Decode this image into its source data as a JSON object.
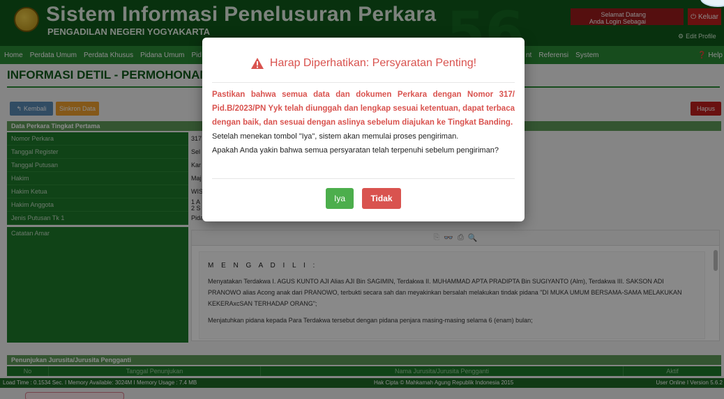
{
  "header": {
    "title": "Sistem Informasi Penelusuran Perkara",
    "subtitle": "PENGADILAN NEGERI YOGYAKARTA",
    "welcome_line1": "Selamat Datang",
    "welcome_line2": "Anda Login Sebagai",
    "logout_label": "Keluar",
    "edit_profile_label": "Edit Profile"
  },
  "nav": {
    "items": [
      "Home",
      "Perdata Umum",
      "Perdata Khusus",
      "Pidana Umum",
      "Pid"
    ],
    "right_items": [
      "nt",
      "Referensi",
      "System"
    ],
    "help_label": "Help"
  },
  "page": {
    "title": "INFORMASI DETIL - PERMOHONAN BAN",
    "back_label": "Kembali",
    "sync_label": "Sinkron Data",
    "delete_label": "Hapus"
  },
  "detail": {
    "section_title": "Data Perkara Tingkat Pertama",
    "rows": [
      {
        "label": "Nomor Perkara",
        "value": "317"
      },
      {
        "label": "Tanggal Register",
        "value": "Sel"
      },
      {
        "label": "Tanggal Putusan",
        "value": "Kar"
      },
      {
        "label": "Hakim",
        "value": "Maj"
      },
      {
        "label": "Hakim Ketua",
        "value": "WIS"
      },
      {
        "label": "Hakim Anggota",
        "value_line1": "1 A",
        "value_line2": "2 S"
      },
      {
        "label": "Jenis Putusan Tk 1",
        "value": "Pidana Penjara Waktu Tertentu"
      },
      {
        "label": "Catatan Amar"
      }
    ]
  },
  "amar": {
    "heading": "M E N G A D I L I :",
    "paragraph1": "Menyatakan Terdakwa I. AGUS KUNTO AJI Alias AJI Bin SAGIMIN, Terdakwa II. MUHAMMAD APTA PRADIPTA Bin SUGIYANTO (Alm), Terdakwa III. SAKSON ADI PRANOWO alias Acong anak dari PRANOWO, terbukti secara sah dan meyakinkan bersalah melakukan tindak pidana \"DI MUKA UMUM  BERSAMA-SAMA MELAKUKAN KEKERAxcSAN TERHADAP ORANG\";",
    "paragraph2": "Menjatuhkan pidana kepada Para Terdakwa tersebut dengan pidana penjara masing-masing selama 6 (enam) bulan;"
  },
  "jurusita": {
    "section_title": "Penunjukan Jurusita/Jurusita Pengganti",
    "columns": [
      "No",
      "Tanggal Penunjukan",
      "Nama Jurusita/Jurusita Pengganti",
      "Aktif"
    ]
  },
  "footer": {
    "left": "Load Time : 0.1534 Sec. I Memory Available: 3024M I Memory Usage : 7.4 MB",
    "center": "Hak Cipta © Mahkamah Agung Republik Indonesia 2015",
    "right": "User Online I Version 5.6.2"
  },
  "modal": {
    "title": "Harap Diperhatikan: Persyaratan Penting!",
    "warning": "Pastikan bahwa semua data dan dokumen Perkara dengan Nomor 317/ Pid.B/2023/PN Yyk telah diunggah dan lengkap sesuai ketentuan, dapat terbaca dengan baik, dan sesuai dengan aslinya sebelum diajukan ke Tingkat Banding.",
    "info1": "Setelah menekan tombol \"Iya\", sistem akan memulai proses pengiriman.",
    "info2": "Apakah Anda yakin bahwa semua persyaratan telah terpenuhi sebelum pengiriman?",
    "yes_label": "Iya",
    "no_label": "Tidak"
  },
  "colors": {
    "header_bg": "#0f5a1a",
    "nav_bg": "#2b8a36",
    "danger": "#d9534f",
    "success": "#4cae4c"
  }
}
